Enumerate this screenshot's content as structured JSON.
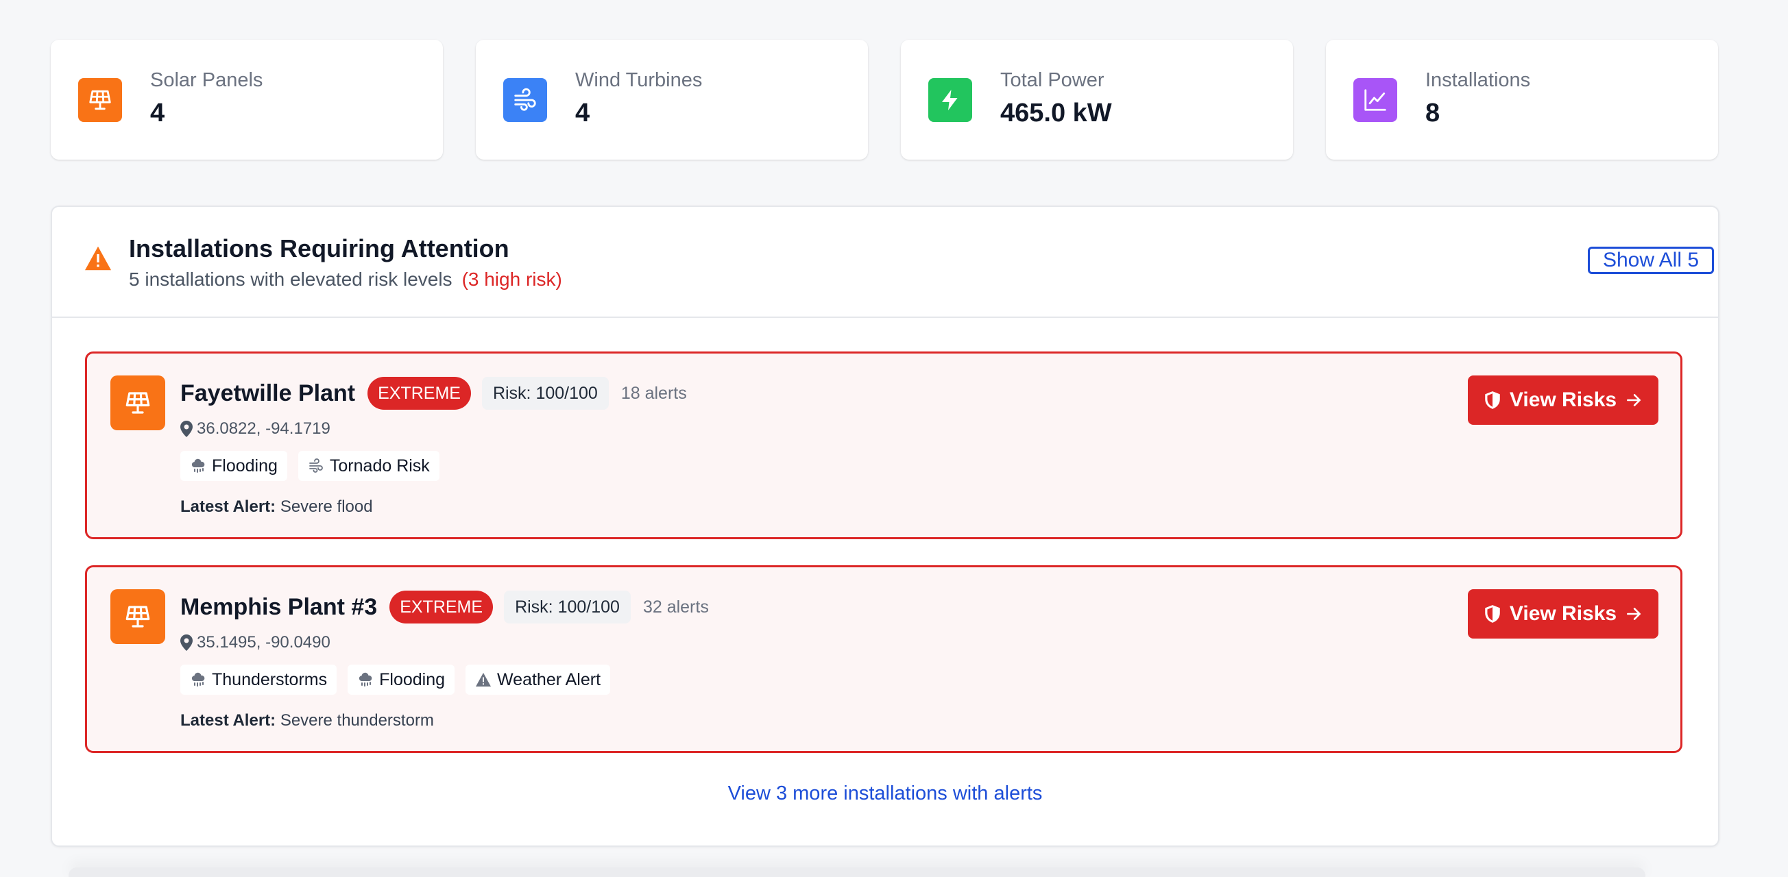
{
  "stats": [
    {
      "label": "Solar Panels",
      "value": "4",
      "icon": "solar-panel-icon",
      "color": "#f97316"
    },
    {
      "label": "Wind Turbines",
      "value": "4",
      "icon": "wind-icon",
      "color": "#3b82f6"
    },
    {
      "label": "Total Power",
      "value": "465.0 kW",
      "icon": "lightning-icon",
      "color": "#22c55e"
    },
    {
      "label": "Installations",
      "value": "8",
      "icon": "chart-line-icon",
      "color": "#a855f7"
    }
  ],
  "attention": {
    "title": "Installations Requiring Attention",
    "subtitle": "5 installations with elevated risk levels",
    "high_risk": "(3 high risk)",
    "show_all": "Show All 5",
    "more_link": "View 3 more installations with alerts"
  },
  "installations": [
    {
      "name": "Fayetwille Plant",
      "severity": "EXTREME",
      "risk": "Risk: 100/100",
      "alerts": "18 alerts",
      "coords": "36.0822, -94.1719",
      "tags": [
        {
          "label": "Flooding",
          "icon": "rain-icon"
        },
        {
          "label": "Tornado Risk",
          "icon": "wind-icon"
        }
      ],
      "latest_label": "Latest Alert:",
      "latest_text": "Severe flood",
      "action": "View Risks"
    },
    {
      "name": "Memphis Plant #3",
      "severity": "EXTREME",
      "risk": "Risk: 100/100",
      "alerts": "32 alerts",
      "coords": "35.1495, -90.0490",
      "tags": [
        {
          "label": "Thunderstorms",
          "icon": "rain-icon"
        },
        {
          "label": "Flooding",
          "icon": "rain-icon"
        },
        {
          "label": "Weather Alert",
          "icon": "warning-icon"
        }
      ],
      "latest_label": "Latest Alert:",
      "latest_text": "Severe thunderstorm",
      "action": "View Risks"
    }
  ],
  "colors": {
    "danger": "#dc2626",
    "link": "#1d4ed8",
    "warning": "#f97316"
  }
}
